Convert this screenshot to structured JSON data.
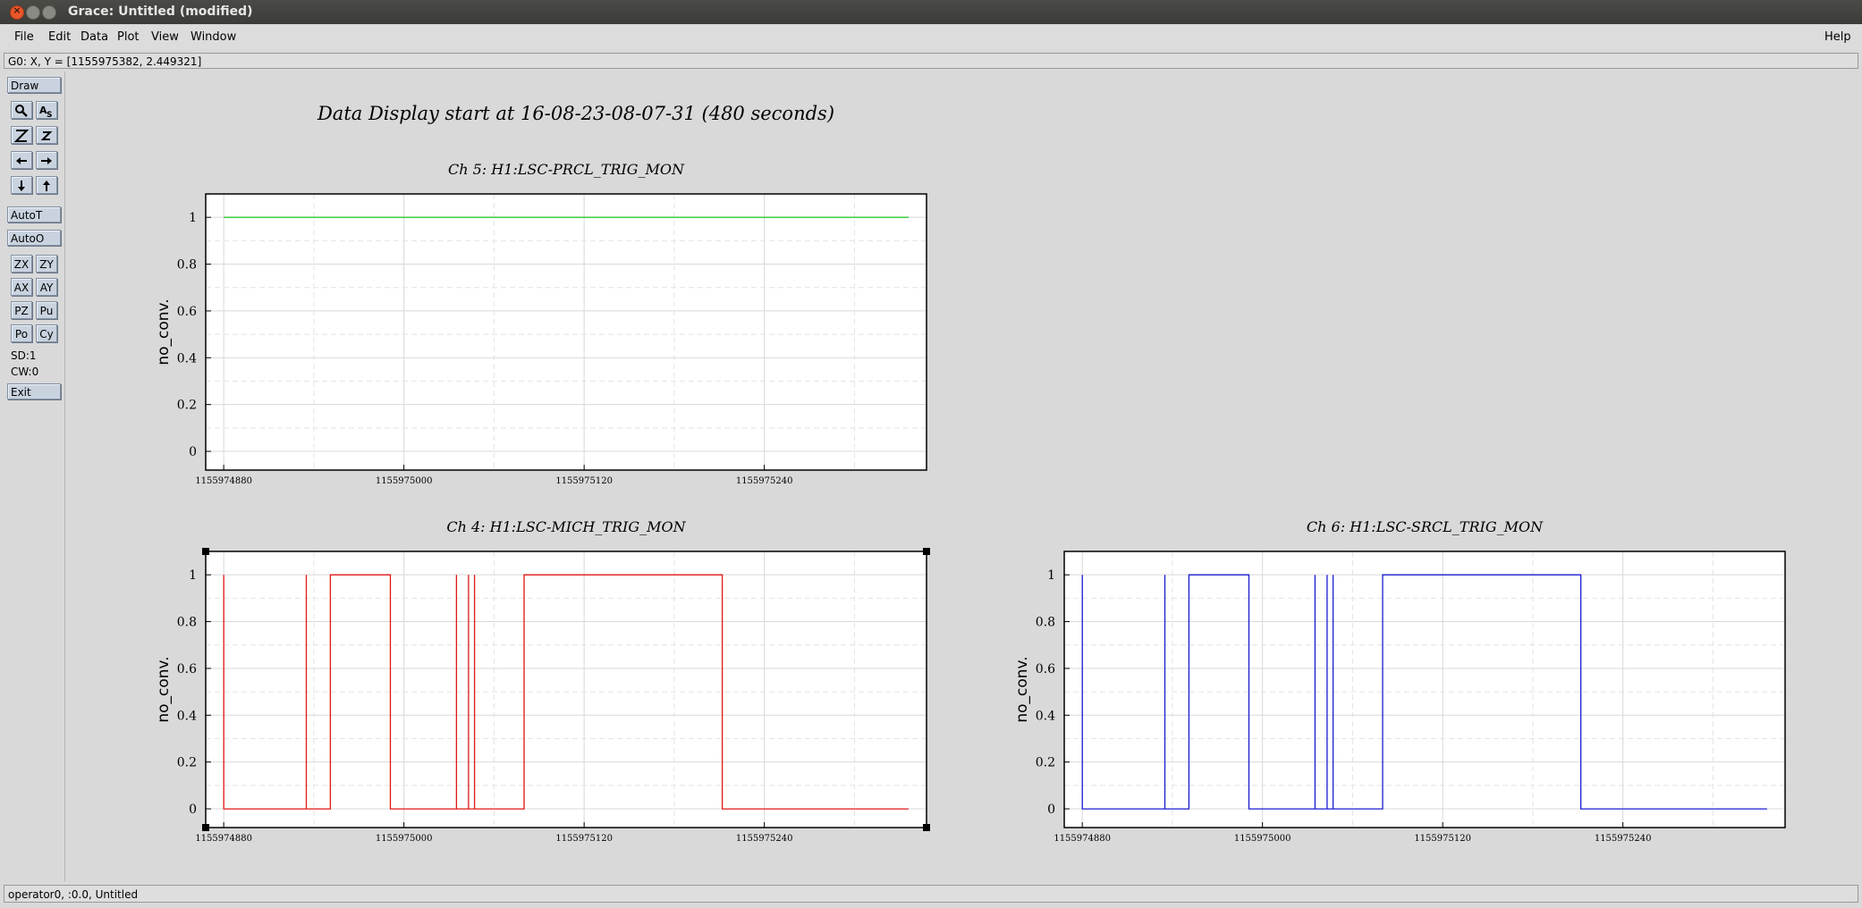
{
  "window": {
    "title": "Grace: Untitled (modified)"
  },
  "menubar": {
    "items": [
      {
        "label": "File"
      },
      {
        "label": "Edit"
      },
      {
        "label": "Data"
      },
      {
        "label": "Plot"
      },
      {
        "label": "View"
      },
      {
        "label": "Window"
      }
    ],
    "help_label": "Help"
  },
  "locator": {
    "text": "G0: X, Y = [1155975382, 2.449321]"
  },
  "toolbar": {
    "draw_label": "Draw",
    "autot_label": "AutoT",
    "autoo_label": "AutoO",
    "zx": "ZX",
    "zy": "ZY",
    "ax": "AX",
    "ay": "AY",
    "pz": "PZ",
    "pu": "Pu",
    "po": "Po",
    "cy": "Cy",
    "sd": "SD:1",
    "cw": "CW:0",
    "exit_label": "Exit"
  },
  "page_title": "Data Display start at 16-08-23-08-07-31 (480 seconds)",
  "chart_data": [
    {
      "type": "line",
      "title": "Ch 5: H1:LSC-PRCL_TRIG_MON",
      "ylabel": "no_conv.",
      "xlim": [
        1155974868,
        1155975348
      ],
      "ylim": [
        -0.08,
        1.1
      ],
      "xticks": [
        1155974880,
        1155975000,
        1155975120,
        1155975240
      ],
      "xtick_labels": [
        "1155974880",
        "1155975000",
        "1155975120",
        "1155975240"
      ],
      "yticks": [
        0,
        0.2,
        0.4,
        0.6,
        0.8,
        1
      ],
      "ytick_labels": [
        "0",
        "0.2",
        "0.4",
        "0.6",
        "0.8",
        "1"
      ],
      "grid": true,
      "color": "#2ec82e",
      "points": [
        [
          1155974880,
          1
        ],
        [
          1155975336,
          1
        ]
      ]
    },
    {
      "type": "line",
      "title": "Ch 4: H1:LSC-MICH_TRIG_MON",
      "ylabel": "no_conv.",
      "xlim": [
        1155974868,
        1155975348
      ],
      "ylim": [
        -0.08,
        1.1
      ],
      "xticks": [
        1155974880,
        1155975000,
        1155975120,
        1155975240
      ],
      "xtick_labels": [
        "1155974880",
        "1155975000",
        "1155975120",
        "1155975240"
      ],
      "yticks": [
        0,
        0.2,
        0.4,
        0.6,
        0.8,
        1
      ],
      "ytick_labels": [
        "0",
        "0.2",
        "0.4",
        "0.6",
        "0.8",
        "1"
      ],
      "grid": true,
      "color": "#e01515",
      "points": [
        [
          1155974880,
          0
        ],
        [
          1155974880,
          1
        ],
        [
          1155974880,
          0
        ],
        [
          1155974935,
          0
        ],
        [
          1155974935,
          1
        ],
        [
          1155974935,
          0
        ],
        [
          1155974951,
          0
        ],
        [
          1155974951,
          1
        ],
        [
          1155974991,
          1
        ],
        [
          1155974991,
          0
        ],
        [
          1155975035,
          0
        ],
        [
          1155975035,
          1
        ],
        [
          1155975035,
          0
        ],
        [
          1155975043,
          0
        ],
        [
          1155975043,
          1
        ],
        [
          1155975043,
          0
        ],
        [
          1155975047,
          0
        ],
        [
          1155975047,
          1
        ],
        [
          1155975047,
          0
        ],
        [
          1155975080,
          0
        ],
        [
          1155975080,
          1
        ],
        [
          1155975212,
          1
        ],
        [
          1155975212,
          0
        ],
        [
          1155975336,
          0
        ]
      ]
    },
    {
      "type": "line",
      "title": "Ch 6: H1:LSC-SRCL_TRIG_MON",
      "ylabel": "no_conv.",
      "xlim": [
        1155974868,
        1155975348
      ],
      "ylim": [
        -0.08,
        1.1
      ],
      "xticks": [
        1155974880,
        1155975000,
        1155975120,
        1155975240
      ],
      "xtick_labels": [
        "1155974880",
        "1155975000",
        "1155975120",
        "1155975240"
      ],
      "yticks": [
        0,
        0.2,
        0.4,
        0.6,
        0.8,
        1
      ],
      "ytick_labels": [
        "0",
        "0.2",
        "0.4",
        "0.6",
        "0.8",
        "1"
      ],
      "grid": true,
      "color": "#1a1ad0",
      "points": [
        [
          1155974880,
          0
        ],
        [
          1155974880,
          1
        ],
        [
          1155974880,
          0
        ],
        [
          1155974935,
          0
        ],
        [
          1155974935,
          1
        ],
        [
          1155974935,
          0
        ],
        [
          1155974951,
          0
        ],
        [
          1155974951,
          1
        ],
        [
          1155974991,
          1
        ],
        [
          1155974991,
          0
        ],
        [
          1155975035,
          0
        ],
        [
          1155975035,
          1
        ],
        [
          1155975035,
          0
        ],
        [
          1155975043,
          0
        ],
        [
          1155975043,
          1
        ],
        [
          1155975043,
          0
        ],
        [
          1155975047,
          0
        ],
        [
          1155975047,
          1
        ],
        [
          1155975047,
          0
        ],
        [
          1155975080,
          0
        ],
        [
          1155975080,
          1
        ],
        [
          1155975212,
          1
        ],
        [
          1155975212,
          0
        ],
        [
          1155975336,
          0
        ]
      ]
    }
  ],
  "bottom_status": {
    "text": "operator0, :0.0, Untitled"
  },
  "colors": {
    "accent": "#c9d3df",
    "titlebar": "#3b3b38"
  },
  "icons": {
    "zoom": "magnifier-icon",
    "text": "text-icon",
    "autoscale": "z-icon",
    "arrows": [
      "left-arrow-icon",
      "right-arrow-icon",
      "down-arrow-icon",
      "up-arrow-icon"
    ]
  }
}
